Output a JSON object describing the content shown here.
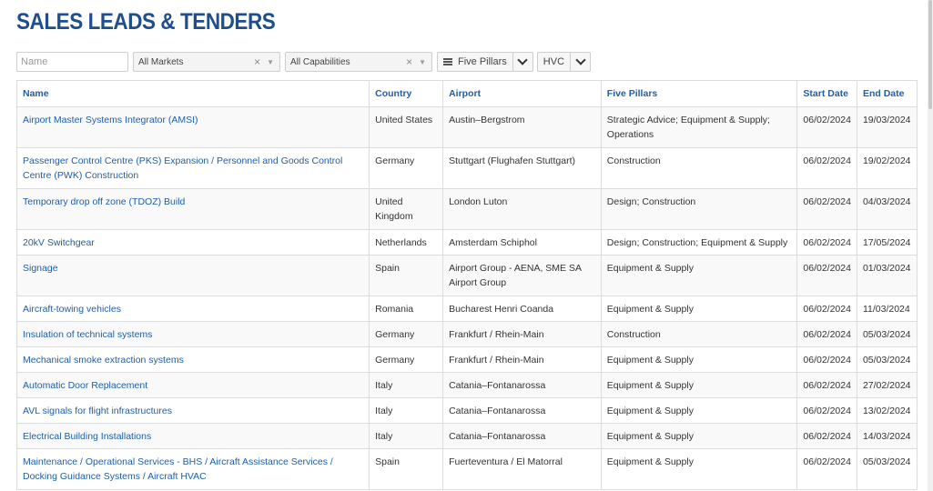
{
  "page": {
    "title": "SALES LEADS & TENDERS"
  },
  "filters": {
    "name_placeholder": "Name",
    "markets": {
      "value": "All Markets",
      "clear": "×"
    },
    "capabilities": {
      "value": "All Capabilities",
      "clear": "×"
    },
    "five_pillars_label": "Five Pillars",
    "hvc_label": "HVC"
  },
  "table": {
    "headers": {
      "name": "Name",
      "country": "Country",
      "airport": "Airport",
      "pillars": "Five Pillars",
      "start": "Start Date",
      "end": "End Date"
    },
    "rows": [
      {
        "name": "Airport Master Systems Integrator (AMSI)",
        "country": "United States",
        "airport": "Austin–Bergstrom",
        "pillars": "Strategic Advice; Equipment & Supply; Operations",
        "start": "06/02/2024",
        "end": "19/03/2024"
      },
      {
        "name": "Passenger Control Centre (PKS) Expansion / Personnel and Goods Control Centre (PWK) Construction",
        "country": "Germany",
        "airport": "Stuttgart (Flughafen Stuttgart)",
        "pillars": "Construction",
        "start": "06/02/2024",
        "end": "19/02/2024"
      },
      {
        "name": "Temporary drop off zone (TDOZ) Build",
        "country": "United Kingdom",
        "airport": "London Luton",
        "pillars": "Design; Construction",
        "start": "06/02/2024",
        "end": "04/03/2024"
      },
      {
        "name": "20kV Switchgear",
        "country": "Netherlands",
        "airport": "Amsterdam Schiphol",
        "pillars": "Design; Construction; Equipment & Supply",
        "start": "06/02/2024",
        "end": "17/05/2024"
      },
      {
        "name": "Signage",
        "country": "Spain",
        "airport": "Airport Group - AENA, SME SA Airport Group",
        "pillars": "Equipment & Supply",
        "start": "06/02/2024",
        "end": "01/03/2024"
      },
      {
        "name": "Aircraft-towing vehicles",
        "country": "Romania",
        "airport": "Bucharest Henri Coanda",
        "pillars": "Equipment & Supply",
        "start": "06/02/2024",
        "end": "11/03/2024"
      },
      {
        "name": "Insulation of technical systems",
        "country": "Germany",
        "airport": "Frankfurt / Rhein-Main",
        "pillars": "Construction",
        "start": "06/02/2024",
        "end": "05/03/2024"
      },
      {
        "name": "Mechanical smoke extraction systems",
        "country": "Germany",
        "airport": "Frankfurt / Rhein-Main",
        "pillars": "Equipment & Supply",
        "start": "06/02/2024",
        "end": "05/03/2024"
      },
      {
        "name": "Automatic Door Replacement",
        "country": "Italy",
        "airport": "Catania–Fontanarossa",
        "pillars": "Equipment & Supply",
        "start": "06/02/2024",
        "end": "27/02/2024"
      },
      {
        "name": "AVL signals for flight infrastructures",
        "country": "Italy",
        "airport": "Catania–Fontanarossa",
        "pillars": "Equipment & Supply",
        "start": "06/02/2024",
        "end": "13/02/2024"
      },
      {
        "name": "Electrical Building Installations",
        "country": "Italy",
        "airport": "Catania–Fontanarossa",
        "pillars": "Equipment & Supply",
        "start": "06/02/2024",
        "end": "14/03/2024"
      },
      {
        "name": "Maintenance / Operational Services - BHS / Aircraft Assistance Services / Docking Guidance Systems / Aircraft HVAC",
        "country": "Spain",
        "airport": "Fuerteventura / El Matorral",
        "pillars": "Equipment & Supply",
        "start": "06/02/2024",
        "end": "05/03/2024"
      }
    ]
  }
}
